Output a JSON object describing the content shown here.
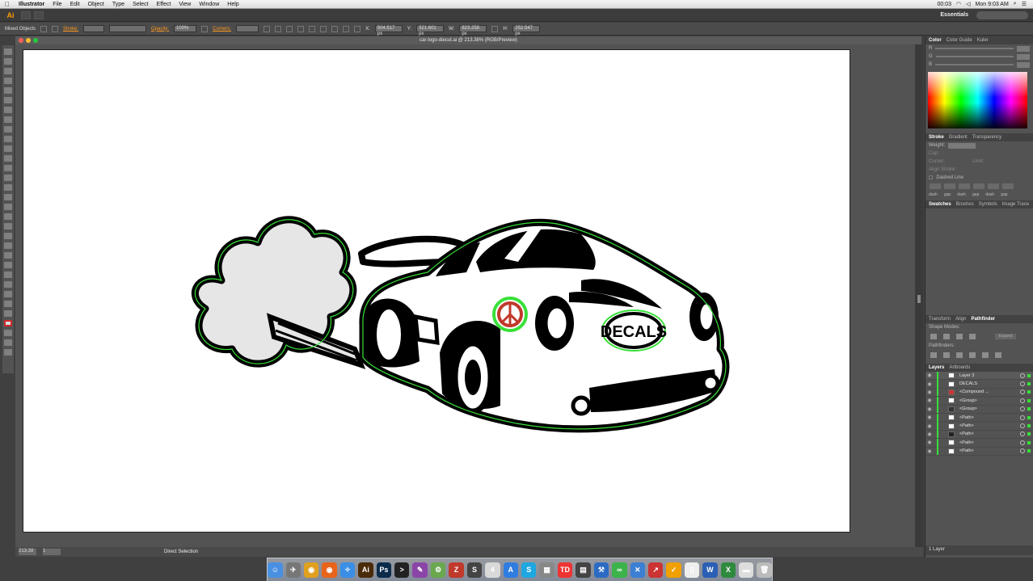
{
  "menubar": {
    "app_name": "Illustrator",
    "items": [
      "File",
      "Edit",
      "Object",
      "Type",
      "Select",
      "Effect",
      "View",
      "Window",
      "Help"
    ],
    "battery": "00:03",
    "clock": "Mon 9:03 AM"
  },
  "appbar": {
    "logo": "Ai",
    "workspace": "Essentials"
  },
  "controlbar": {
    "selection_label": "Mixed Objects",
    "stroke_label": "Stroke:",
    "opacity_label": "Opacity:",
    "opacity_value": "100%",
    "corners_label": "Corners:",
    "x_label": "X:",
    "x_value": "504.517 px",
    "y_label": "Y:",
    "y_value": "321.601 px",
    "w_label": "W:",
    "w_value": "823.258 px",
    "h_label": "H:",
    "h_value": "252.547 px"
  },
  "document": {
    "title": "car-logo-diecut.ai @ 213.38% (RGB/Preview)",
    "decal_text": "DECALS"
  },
  "statusbar": {
    "zoom": "213.38",
    "artboard": "1",
    "current_tool": "Direct Selection"
  },
  "panels": {
    "color_tabs": [
      "Color",
      "Color Guide",
      "Kuler"
    ],
    "color_channels": [
      "R",
      "G",
      "B"
    ],
    "stroke_tabs": [
      "Stroke",
      "Gradient",
      "Transparency"
    ],
    "weight_label": "Weight:",
    "cap_label": "Cap:",
    "corner_label": "Corner:",
    "limit_label": "Limit:",
    "align_stroke_label": "Align Stroke:",
    "dashed_label": "Dashed Line",
    "dash_labels": [
      "dash",
      "gap",
      "dash",
      "gap",
      "dash",
      "gap"
    ],
    "swatch_tabs": [
      "Swatches",
      "Brushes",
      "Symbols",
      "Image Trace"
    ],
    "transform_tabs": [
      "Transform",
      "Align",
      "Pathfinder"
    ],
    "shape_modes_label": "Shape Modes:",
    "expand_label": "Expand",
    "pathfinders_label": "Pathfinders:",
    "layers_tabs": [
      "Layers",
      "Artboards"
    ],
    "layers": [
      {
        "name": "Layer 3",
        "kind": "layer"
      },
      {
        "name": "DECALS",
        "kind": "item"
      },
      {
        "name": "<Compound ...",
        "kind": "item"
      },
      {
        "name": "<Group>",
        "kind": "item"
      },
      {
        "name": "<Group>",
        "kind": "item"
      },
      {
        "name": "<Path>",
        "kind": "item"
      },
      {
        "name": "<Path>",
        "kind": "item"
      },
      {
        "name": "<Path>",
        "kind": "item"
      },
      {
        "name": "<Path>",
        "kind": "item"
      },
      {
        "name": "<Path>",
        "kind": "item"
      }
    ],
    "layers_count": "1 Layer"
  },
  "dock": {
    "apps": [
      {
        "name": "Finder",
        "glyph": "☺",
        "color": "#4a90e2"
      },
      {
        "name": "Launchpad",
        "glyph": "✈",
        "color": "#777"
      },
      {
        "name": "Chrome",
        "glyph": "◉",
        "color": "#e0a020"
      },
      {
        "name": "Firefox",
        "glyph": "◉",
        "color": "#e8641a"
      },
      {
        "name": "Safari",
        "glyph": "✧",
        "color": "#3a8ee6"
      },
      {
        "name": "Illustrator",
        "glyph": "Ai",
        "color": "#4a2b0a"
      },
      {
        "name": "Photoshop",
        "glyph": "Ps",
        "color": "#0b2b4a"
      },
      {
        "name": "Terminal",
        "glyph": ">",
        "color": "#222"
      },
      {
        "name": "Pen",
        "glyph": "✎",
        "color": "#8b45a8"
      },
      {
        "name": "Tools",
        "glyph": "⚙",
        "color": "#6aa84f"
      },
      {
        "name": "FileZilla",
        "glyph": "Z",
        "color": "#c0392b"
      },
      {
        "name": "Scripts",
        "glyph": "S",
        "color": "#444"
      },
      {
        "name": "Calendar",
        "glyph": "4",
        "color": "#d9d9d9"
      },
      {
        "name": "App Store",
        "glyph": "A",
        "color": "#2f7de1"
      },
      {
        "name": "Skype",
        "glyph": "S",
        "color": "#1ea7e1"
      },
      {
        "name": "Calculator",
        "glyph": "▦",
        "color": "#888"
      },
      {
        "name": "Tada",
        "glyph": "TD",
        "color": "#e33"
      },
      {
        "name": "Clapper",
        "glyph": "▤",
        "color": "#444"
      },
      {
        "name": "Xcode",
        "glyph": "⚒",
        "color": "#2c6bc4"
      },
      {
        "name": "Link",
        "glyph": "∞",
        "color": "#3bb34a"
      },
      {
        "name": "Xcode Tools",
        "glyph": "✕",
        "color": "#3b7fd4"
      },
      {
        "name": "Monitor",
        "glyph": "↗",
        "color": "#c33"
      },
      {
        "name": "Tasks",
        "glyph": "✓",
        "color": "#f0a000"
      },
      {
        "name": "Document",
        "glyph": "▯",
        "color": "#eee"
      },
      {
        "name": "Word",
        "glyph": "W",
        "color": "#2b5fb4"
      },
      {
        "name": "Excel",
        "glyph": "X",
        "color": "#2e8b3e"
      },
      {
        "name": "Folder",
        "glyph": "▬",
        "color": "#ddd"
      },
      {
        "name": "Trash",
        "glyph": "🗑",
        "color": "#bbb"
      }
    ]
  },
  "colors": {
    "selection_green": "#38e038",
    "accent_orange": "#ff9b1e"
  }
}
